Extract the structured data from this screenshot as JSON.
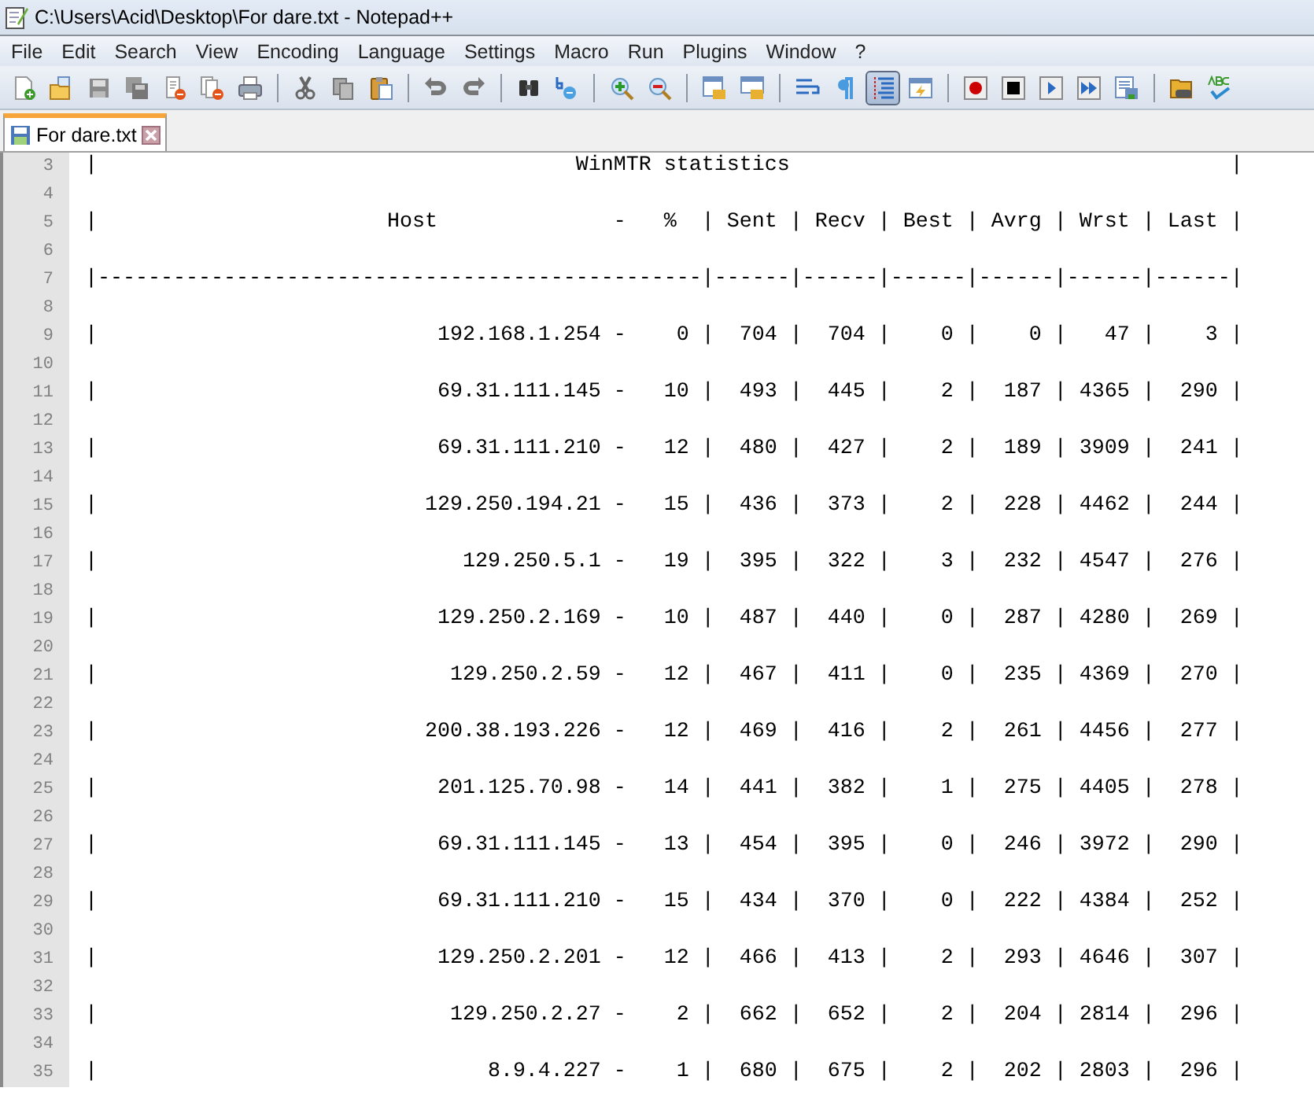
{
  "window": {
    "title": "C:\\Users\\Acid\\Desktop\\For dare.txt - Notepad++"
  },
  "menu": [
    "File",
    "Edit",
    "Search",
    "View",
    "Encoding",
    "Language",
    "Settings",
    "Macro",
    "Run",
    "Plugins",
    "Window",
    "?"
  ],
  "toolbar_groups": [
    [
      {
        "kind": "new",
        "selected": false
      },
      {
        "kind": "open",
        "selected": false
      },
      {
        "kind": "save",
        "selected": false
      },
      {
        "kind": "save-all",
        "selected": false
      },
      {
        "kind": "close",
        "selected": false
      },
      {
        "kind": "close-all",
        "selected": false
      },
      {
        "kind": "print",
        "selected": false
      }
    ],
    [
      {
        "kind": "cut",
        "selected": false
      },
      {
        "kind": "copy",
        "selected": false
      },
      {
        "kind": "paste",
        "selected": false
      }
    ],
    [
      {
        "kind": "undo",
        "selected": false
      },
      {
        "kind": "redo",
        "selected": false
      }
    ],
    [
      {
        "kind": "find",
        "selected": false
      },
      {
        "kind": "replace",
        "selected": false
      }
    ],
    [
      {
        "kind": "zoom-in",
        "selected": false
      },
      {
        "kind": "zoom-out",
        "selected": false
      }
    ],
    [
      {
        "kind": "sync-v",
        "selected": false
      },
      {
        "kind": "sync-h",
        "selected": false
      }
    ],
    [
      {
        "kind": "wrap",
        "selected": false
      },
      {
        "kind": "all-chars",
        "selected": false
      },
      {
        "kind": "indent-guide",
        "selected": true
      },
      {
        "kind": "user-lang",
        "selected": false
      }
    ],
    [
      {
        "kind": "record",
        "selected": false
      },
      {
        "kind": "stop",
        "selected": false
      },
      {
        "kind": "play",
        "selected": false
      },
      {
        "kind": "play-multi",
        "selected": false
      },
      {
        "kind": "save-macro",
        "selected": false
      }
    ],
    [
      {
        "kind": "folder",
        "selected": false
      },
      {
        "kind": "spell"
      }
    ]
  ],
  "tabs": [
    {
      "label": "For dare.txt",
      "selected": true
    }
  ],
  "editor": {
    "lines": [
      {
        "number": "3",
        "text": "|                                      WinMTR statistics                                   |"
      },
      {
        "number": "4"
      },
      {
        "number": "5",
        "text": "|                       Host              -   %  | Sent | Recv | Best | Avrg | Wrst | Last |"
      },
      {
        "number": "6"
      },
      {
        "number": "7",
        "text": "|------------------------------------------------|------|------|------|------|------|------|"
      },
      {
        "number": "8"
      },
      {
        "number": "9",
        "text": "|                           192.168.1.254 -    0 |  704 |  704 |    0 |    0 |   47 |    3 |"
      },
      {
        "number": "10"
      },
      {
        "number": "11",
        "text": "|                           69.31.111.145 -   10 |  493 |  445 |    2 |  187 | 4365 |  290 |"
      },
      {
        "number": "12"
      },
      {
        "number": "13",
        "text": "|                           69.31.111.210 -   12 |  480 |  427 |    2 |  189 | 3909 |  241 |"
      },
      {
        "number": "14"
      },
      {
        "number": "15",
        "text": "|                          129.250.194.21 -   15 |  436 |  373 |    2 |  228 | 4462 |  244 |"
      },
      {
        "number": "16"
      },
      {
        "number": "17",
        "text": "|                             129.250.5.1 -   19 |  395 |  322 |    3 |  232 | 4547 |  276 |"
      },
      {
        "number": "18"
      },
      {
        "number": "19",
        "text": "|                           129.250.2.169 -   10 |  487 |  440 |    0 |  287 | 4280 |  269 |"
      },
      {
        "number": "20"
      },
      {
        "number": "21",
        "text": "|                            129.250.2.59 -   12 |  467 |  411 |    0 |  235 | 4369 |  270 |"
      },
      {
        "number": "22"
      },
      {
        "number": "23",
        "text": "|                          200.38.193.226 -   12 |  469 |  416 |    2 |  261 | 4456 |  277 |"
      },
      {
        "number": "24"
      },
      {
        "number": "25",
        "text": "|                           201.125.70.98 -   14 |  441 |  382 |    1 |  275 | 4405 |  278 |"
      },
      {
        "number": "26"
      },
      {
        "number": "27",
        "text": "|                           69.31.111.145 -   13 |  454 |  395 |    0 |  246 | 3972 |  290 |"
      },
      {
        "number": "28"
      },
      {
        "number": "29",
        "text": "|                           69.31.111.210 -   15 |  434 |  370 |    0 |  222 | 4384 |  252 |"
      },
      {
        "number": "30"
      },
      {
        "number": "31",
        "text": "|                           129.250.2.201 -   12 |  466 |  413 |    2 |  293 | 4646 |  307 |"
      },
      {
        "number": "32"
      },
      {
        "number": "33",
        "text": "|                            129.250.2.27 -    2 |  662 |  652 |    2 |  204 | 2814 |  296 |"
      },
      {
        "number": "34"
      },
      {
        "number": "35",
        "text": "|                               8.9.4.227 -    1 |  680 |  675 |    2 |  202 | 2803 |  296 |"
      }
    ]
  }
}
